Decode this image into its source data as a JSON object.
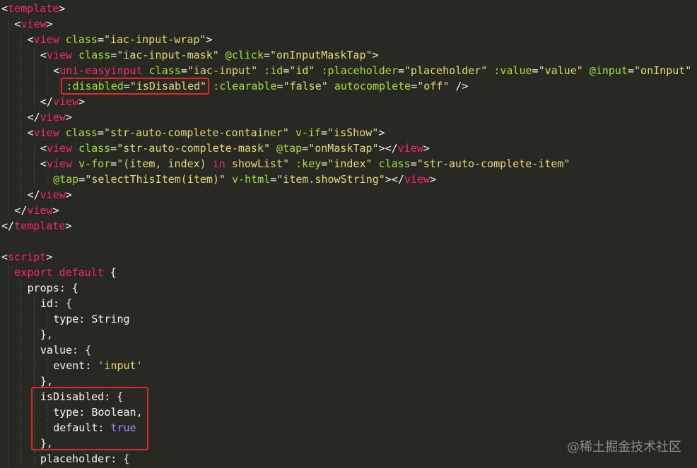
{
  "editor": {
    "background": "#282923",
    "lines": [
      {
        "indent": 0,
        "parts": [
          [
            "<",
            "punc"
          ],
          [
            "template",
            "tag"
          ],
          [
            ">",
            "punc"
          ]
        ]
      },
      {
        "indent": 1,
        "parts": [
          [
            "<",
            "punc"
          ],
          [
            "view",
            "tag"
          ],
          [
            ">",
            "punc"
          ]
        ]
      },
      {
        "indent": 2,
        "parts": [
          [
            "<",
            "punc"
          ],
          [
            "view",
            "tag"
          ],
          [
            " "
          ],
          [
            "class",
            "attr"
          ],
          [
            "="
          ],
          [
            "\"iac-input-wrap\"",
            "str"
          ],
          [
            ">",
            "punc"
          ]
        ]
      },
      {
        "indent": 3,
        "parts": [
          [
            "<",
            "punc"
          ],
          [
            "view",
            "tag"
          ],
          [
            " "
          ],
          [
            "class",
            "attr"
          ],
          [
            "="
          ],
          [
            "\"iac-input-mask\"",
            "str"
          ],
          [
            " "
          ],
          [
            "@click",
            "attr"
          ],
          [
            "="
          ],
          [
            "\"onInputMaskTap\"",
            "str"
          ],
          [
            ">",
            "punc"
          ]
        ]
      },
      {
        "indent": 4,
        "parts": [
          [
            "<",
            "punc"
          ],
          [
            "uni-easyinput",
            "tag"
          ],
          [
            " "
          ],
          [
            "class",
            "attr"
          ],
          [
            "="
          ],
          [
            "\"iac-input\"",
            "str"
          ],
          [
            " "
          ],
          [
            ":id",
            "attr"
          ],
          [
            "="
          ],
          [
            "\"id\"",
            "str"
          ],
          [
            " "
          ],
          [
            ":placeholder",
            "attr"
          ],
          [
            "="
          ],
          [
            "\"placeholder\"",
            "str"
          ],
          [
            " "
          ],
          [
            ":value",
            "attr"
          ],
          [
            "="
          ],
          [
            "\"value\"",
            "str"
          ],
          [
            " "
          ],
          [
            "@input",
            "attr"
          ],
          [
            "="
          ],
          [
            "\"onInput\"",
            "str"
          ]
        ]
      },
      {
        "indent": 5,
        "parts": [
          [
            ":disabled",
            "attr"
          ],
          [
            "="
          ],
          [
            "\"isDisabled\"",
            "str"
          ],
          [
            " "
          ],
          [
            ":clearable",
            "attr"
          ],
          [
            "="
          ],
          [
            "\"false\"",
            "str"
          ],
          [
            " "
          ],
          [
            "autocomplete",
            "attr"
          ],
          [
            "="
          ],
          [
            "\"off\"",
            "str"
          ],
          [
            " />"
          ]
        ]
      },
      {
        "indent": 3,
        "parts": [
          [
            "</",
            "punc"
          ],
          [
            "view",
            "tag"
          ],
          [
            ">",
            "punc"
          ]
        ]
      },
      {
        "indent": 2,
        "parts": [
          [
            "</",
            "punc"
          ],
          [
            "view",
            "tag"
          ],
          [
            ">",
            "punc"
          ]
        ]
      },
      {
        "indent": 2,
        "parts": [
          [
            "<",
            "punc"
          ],
          [
            "view",
            "tag"
          ],
          [
            " "
          ],
          [
            "class",
            "attr"
          ],
          [
            "="
          ],
          [
            "\"str-auto-complete-container\"",
            "str"
          ],
          [
            " "
          ],
          [
            "v-if",
            "attr"
          ],
          [
            "="
          ],
          [
            "\"isShow\"",
            "str"
          ],
          [
            ">",
            "punc"
          ]
        ]
      },
      {
        "indent": 3,
        "parts": [
          [
            "<",
            "punc"
          ],
          [
            "view",
            "tag"
          ],
          [
            " "
          ],
          [
            "class",
            "attr"
          ],
          [
            "="
          ],
          [
            "\"str-auto-complete-mask\"",
            "str"
          ],
          [
            " "
          ],
          [
            "@tap",
            "attr"
          ],
          [
            "="
          ],
          [
            "\"onMaskTap\"",
            "str"
          ],
          [
            "></",
            "punc"
          ],
          [
            "view",
            "tag"
          ],
          [
            ">",
            "punc"
          ]
        ]
      },
      {
        "indent": 3,
        "parts": [
          [
            "<",
            "punc"
          ],
          [
            "view",
            "tag"
          ],
          [
            " "
          ],
          [
            "v-for",
            "attr"
          ],
          [
            "="
          ],
          [
            "\"(item, index) ",
            "str"
          ],
          [
            "in",
            "kw"
          ],
          [
            " showList\"",
            "str"
          ],
          [
            " "
          ],
          [
            ":key",
            "attr"
          ],
          [
            "="
          ],
          [
            "\"index\"",
            "str"
          ],
          [
            " "
          ],
          [
            "class",
            "attr"
          ],
          [
            "="
          ],
          [
            "\"str-auto-complete-item\"",
            "str"
          ]
        ]
      },
      {
        "indent": 4,
        "parts": [
          [
            "@tap",
            "attr"
          ],
          [
            "="
          ],
          [
            "\"selectThisItem(item)\"",
            "str"
          ],
          [
            " "
          ],
          [
            "v-html",
            "attr"
          ],
          [
            "="
          ],
          [
            "\"item.showString\"",
            "str"
          ],
          [
            "></",
            "punc"
          ],
          [
            "view",
            "tag"
          ],
          [
            ">",
            "punc"
          ]
        ]
      },
      {
        "indent": 2,
        "parts": [
          [
            "</",
            "punc"
          ],
          [
            "view",
            "tag"
          ],
          [
            ">",
            "punc"
          ]
        ]
      },
      {
        "indent": 1,
        "parts": [
          [
            "</",
            "punc"
          ],
          [
            "view",
            "tag"
          ],
          [
            ">",
            "punc"
          ]
        ]
      },
      {
        "indent": 0,
        "parts": [
          [
            "</",
            "punc"
          ],
          [
            "template",
            "tag"
          ],
          [
            ">",
            "punc"
          ]
        ]
      },
      {
        "indent": 0,
        "parts": []
      },
      {
        "indent": 0,
        "parts": [
          [
            "<",
            "punc"
          ],
          [
            "script",
            "tag"
          ],
          [
            ">",
            "punc"
          ]
        ]
      },
      {
        "indent": 1,
        "parts": [
          [
            "export",
            "kw"
          ],
          [
            " "
          ],
          [
            "default",
            "kw"
          ],
          [
            " {"
          ]
        ]
      },
      {
        "indent": 2,
        "parts": [
          [
            "props: {"
          ]
        ]
      },
      {
        "indent": 3,
        "parts": [
          [
            "id: {"
          ]
        ]
      },
      {
        "indent": 4,
        "parts": [
          [
            "type: String"
          ]
        ]
      },
      {
        "indent": 3,
        "parts": [
          [
            "},"
          ]
        ]
      },
      {
        "indent": 3,
        "parts": [
          [
            "value: {"
          ]
        ]
      },
      {
        "indent": 4,
        "parts": [
          [
            "event: "
          ],
          [
            "'input'",
            "str"
          ]
        ]
      },
      {
        "indent": 3,
        "parts": [
          [
            "},"
          ]
        ]
      },
      {
        "indent": 3,
        "parts": [
          [
            "isDisabled: {"
          ]
        ]
      },
      {
        "indent": 4,
        "parts": [
          [
            "type: Boolean,"
          ]
        ]
      },
      {
        "indent": 4,
        "parts": [
          [
            "default: "
          ],
          [
            "true",
            "bool"
          ]
        ]
      },
      {
        "indent": 3,
        "parts": [
          [
            "},"
          ]
        ]
      },
      {
        "indent": 3,
        "parts": [
          [
            "placeholder: {"
          ]
        ]
      }
    ]
  },
  "highlights": [
    "disabled-attribute-highlight",
    "isdisabled-prop-highlight"
  ],
  "watermark": "@稀土掘金技术社区",
  "colors": {
    "tag": "#f92672",
    "attr": "#a6e22e",
    "string": "#e6db74",
    "boolean": "#ae81ff",
    "highlight": "#e0282b"
  }
}
